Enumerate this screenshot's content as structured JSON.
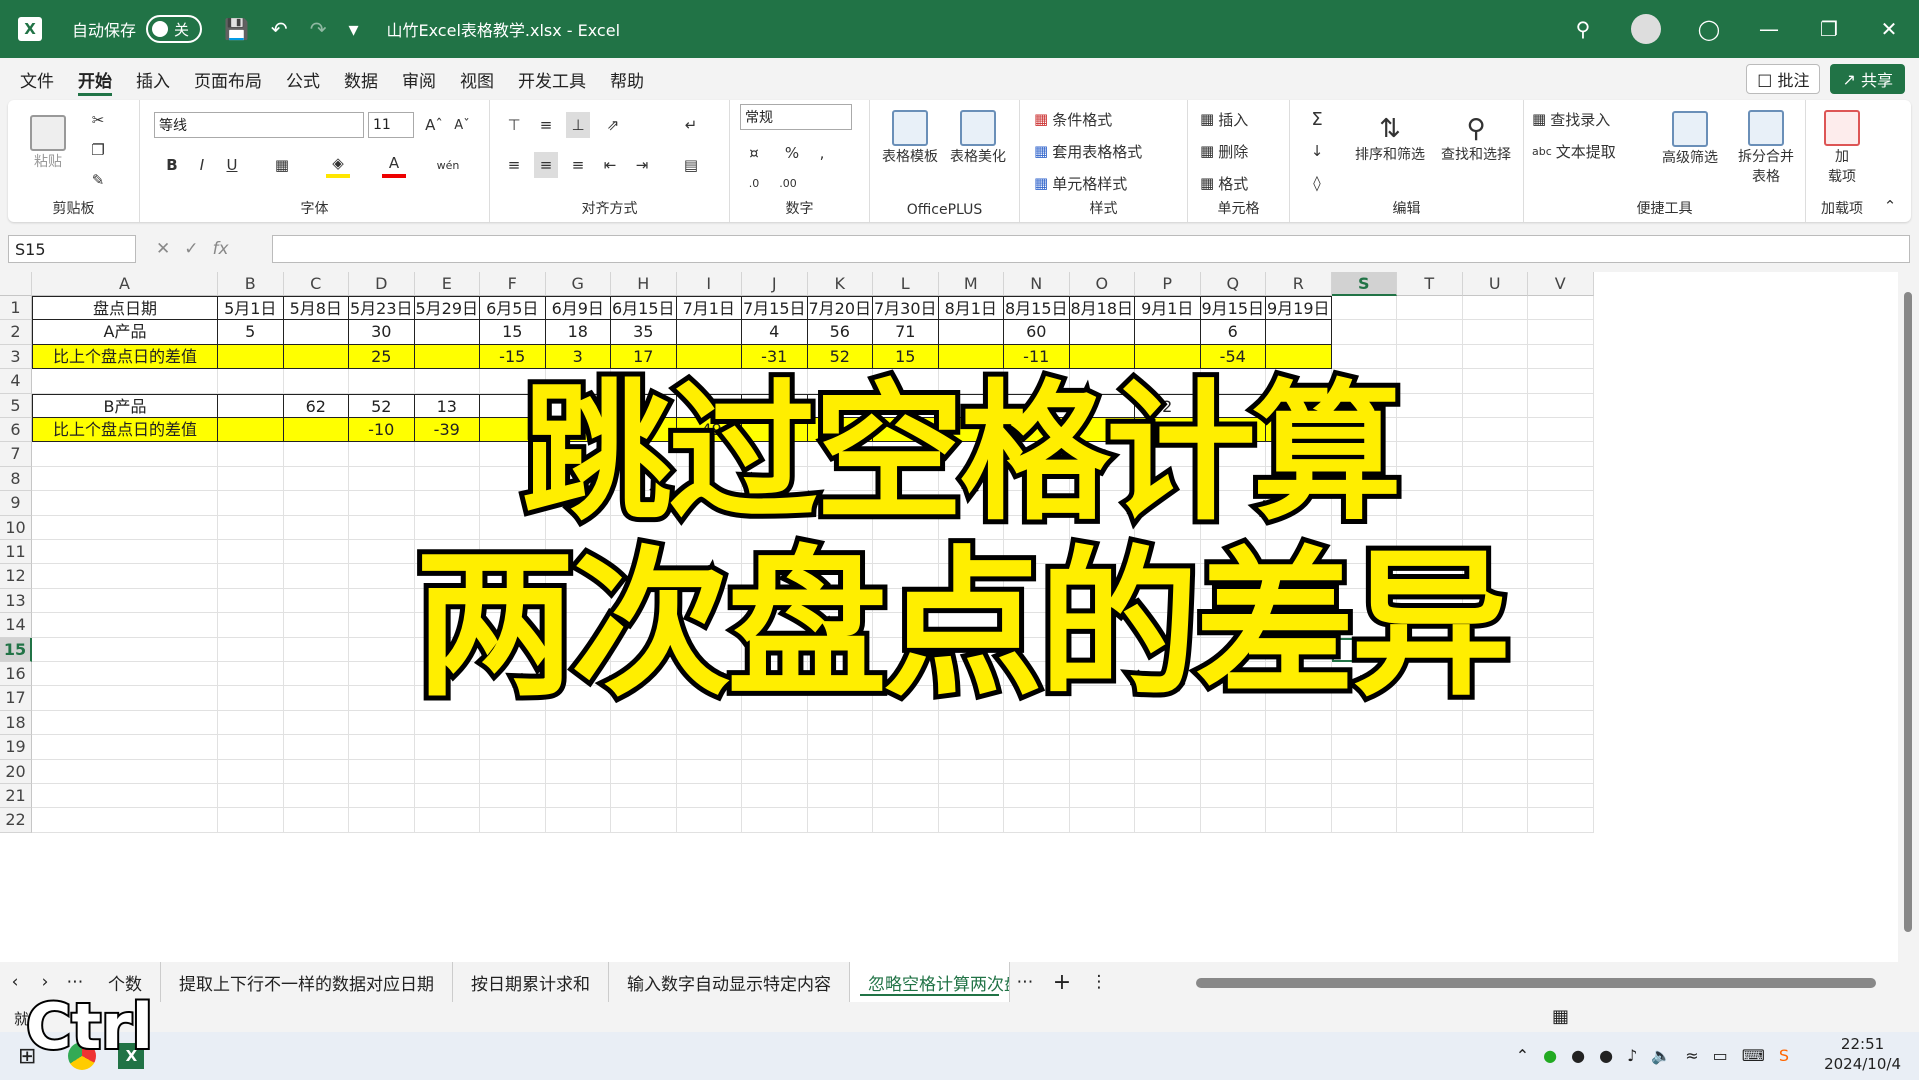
{
  "titlebar": {
    "autosave_label": "自动保存",
    "autosave_state": "关",
    "doc_title": "山竹Excel表格教学.xlsx - Excel",
    "accent": "#217346"
  },
  "menu": {
    "items": [
      "文件",
      "开始",
      "插入",
      "页面布局",
      "公式",
      "数据",
      "审阅",
      "视图",
      "开发工具",
      "帮助"
    ],
    "active": "开始",
    "comment": "批注",
    "share": "共享"
  },
  "ribbon": {
    "clipboard": {
      "label": "剪贴板",
      "paste": "粘贴"
    },
    "font": {
      "label": "字体",
      "name": "等线",
      "size": "11"
    },
    "align": {
      "label": "对齐方式"
    },
    "number": {
      "label": "数字",
      "format": "常规"
    },
    "officeplus": {
      "label": "OfficePLUS",
      "tmpl": "表格模板",
      "beauty": "表格美化"
    },
    "styles": {
      "label": "样式",
      "cond": "条件格式",
      "table": "套用表格格式",
      "cell": "单元格样式"
    },
    "cells": {
      "label": "单元格",
      "insert": "插入",
      "delete": "删除",
      "format": "格式"
    },
    "edit": {
      "label": "编辑",
      "sort": "排序和筛选",
      "find": "查找和选择"
    },
    "tools": {
      "label": "便捷工具",
      "lookup": "查找录入",
      "extract": "文本提取",
      "adv": "高级筛选",
      "split": "拆分合并",
      "split2": "表格"
    },
    "addins": {
      "label": "加载项",
      "a1": "加",
      "a2": "载项"
    }
  },
  "namebox": "S15",
  "columns": [
    "A",
    "B",
    "C",
    "D",
    "E",
    "F",
    "G",
    "H",
    "I",
    "J",
    "K",
    "L",
    "M",
    "N",
    "O",
    "P",
    "Q",
    "R",
    "S",
    "T",
    "U",
    "V"
  ],
  "rows": [
    "1",
    "2",
    "3",
    "4",
    "5",
    "6",
    "7",
    "8",
    "9",
    "10",
    "11",
    "12",
    "13",
    "14",
    "15",
    "16",
    "17",
    "18",
    "19",
    "20",
    "21",
    "22"
  ],
  "sheet": {
    "r1": [
      "盘点日期",
      "5月1日",
      "5月8日",
      "5月23日",
      "5月29日",
      "6月5日",
      "6月9日",
      "6月15日",
      "7月1日",
      "7月15日",
      "7月20日",
      "7月30日",
      "8月1日",
      "8月15日",
      "8月18日",
      "9月1日",
      "9月15日",
      "9月19日"
    ],
    "r2": [
      "A产品",
      "5",
      "",
      "30",
      "",
      "15",
      "18",
      "35",
      "",
      "4",
      "56",
      "71",
      "",
      "60",
      "",
      "",
      "6",
      ""
    ],
    "r3": [
      "比上个盘点日的差值",
      "",
      "",
      "25",
      "",
      "-15",
      "3",
      "17",
      "",
      "-31",
      "52",
      "15",
      "",
      "-11",
      "",
      "",
      "-54",
      ""
    ],
    "r5": [
      "B产品",
      "",
      "62",
      "52",
      "13",
      "",
      "",
      "",
      "6",
      "",
      "",
      "",
      "",
      "",
      "",
      "2",
      "",
      "15"
    ],
    "r6": [
      "比上个盘点日的差值",
      "",
      "",
      "-10",
      "-39",
      "",
      "",
      "",
      "-49",
      "",
      "",
      "",
      "",
      "",
      "",
      "48",
      "",
      "3"
    ]
  },
  "overlay": {
    "line1": "跳过空格计算",
    "line2": "两次盘点的差异"
  },
  "tabs": [
    "个数",
    "提取上下行不一样的数据对应日期",
    "按日期累计求和",
    "输入数字自动显示特定内容",
    "忽略空格计算两次盘点"
  ],
  "active_tab": "忽略空格计算两次盘点",
  "status": {
    "ready": "就绪"
  },
  "keycap": "Ctrl",
  "clock": {
    "time": "22:51",
    "date": "2024/10/4"
  }
}
